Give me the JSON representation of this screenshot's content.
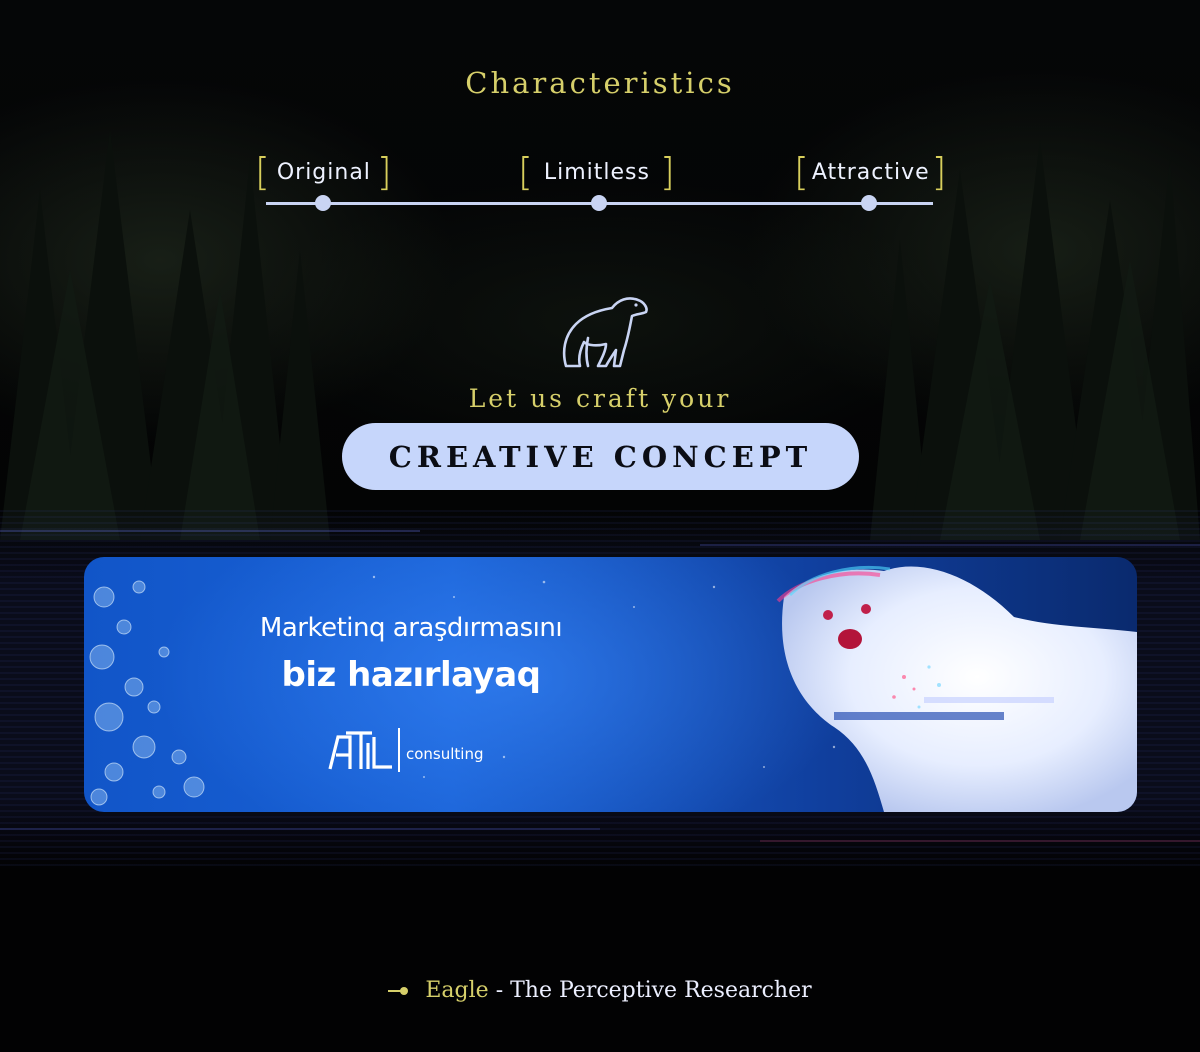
{
  "page": {
    "title": "Characteristics",
    "characteristics": [
      {
        "label": "Original"
      },
      {
        "label": "Limitless"
      },
      {
        "label": "Attractive"
      }
    ],
    "tagline": "Let us craft your",
    "concept_label": "CREATIVE CONCEPT",
    "bear_icon": "polar-bear-icon"
  },
  "banner": {
    "line1": "Marketinq araşdırmasını",
    "line2": "biz hazırlayaq",
    "logo_text": "consulting"
  },
  "footer": {
    "name": "Eagle",
    "rest": " - The Perceptive Researcher"
  },
  "colors": {
    "accent_gold": "#d6cf6a",
    "pill_bg": "#c6d6fb",
    "timeline": "#c9d4f3",
    "banner_blue": "#1155c8"
  }
}
